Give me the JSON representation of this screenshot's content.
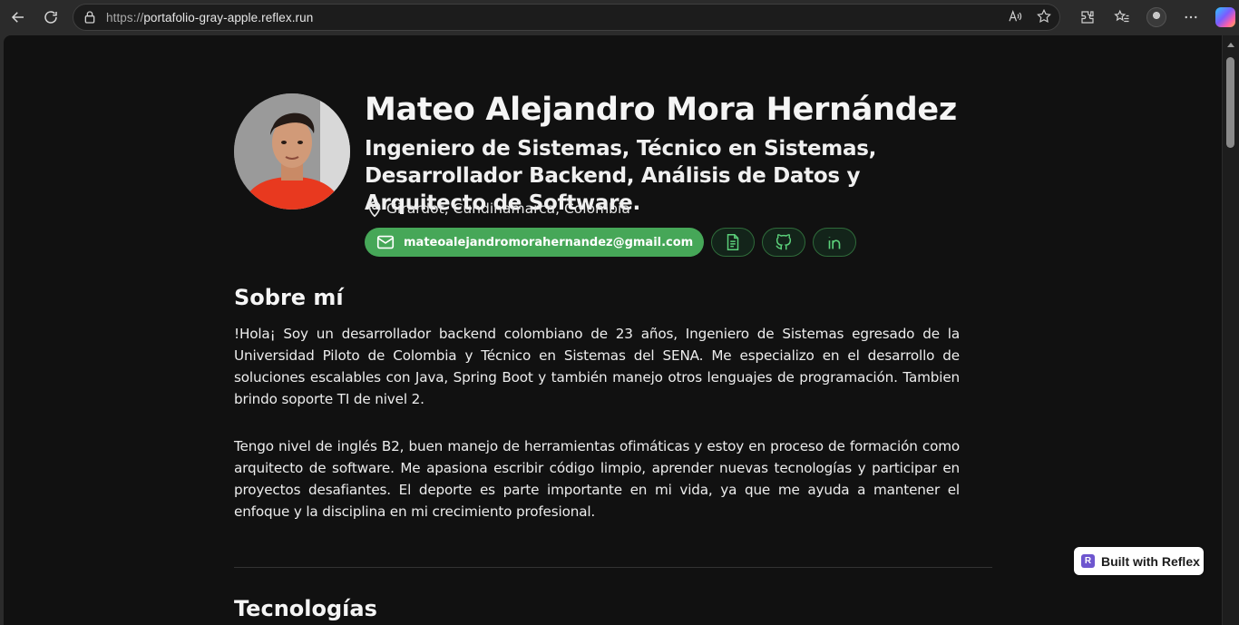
{
  "browser": {
    "url_scheme": "https://",
    "url_host": "portafolio-gray-apple.reflex.run"
  },
  "profile": {
    "name": "Mateo Alejandro Mora Hernández",
    "subtitle": "Ingeniero de Sistemas, Técnico en Sistemas, Desarrollador Backend, Análisis de Datos y Arquitecto de Software.",
    "location": "Girardot, Cundinamarca, Colombia",
    "email": "mateoalejandromorahernandez@gmail.com"
  },
  "about": {
    "title": "Sobre mí",
    "paragraph1": "!Hola¡ Soy un desarrollador backend colombiano de 23 años, Ingeniero de Sistemas egresado de la Universidad Piloto de Colombia y Técnico en Sistemas del SENA. Me especializo en el desarrollo de soluciones escalables con Java, Spring Boot y también manejo otros lenguajes de programación. Tambien brindo soporte TI de nivel 2.",
    "paragraph2": "Tengo nivel de inglés B2, buen manejo de herramientas ofimáticas y estoy en proceso de formación como arquitecto de software. Me apasiona escribir código limpio, aprender nuevas tecnologías y participar en proyectos desafiantes. El deporte es parte importante en mi vida, ya que me ayuda a mantener el enfoque y la disciplina en mi crecimiento profesional."
  },
  "technologies": {
    "title": "Tecnologías"
  },
  "badge": {
    "label": "Built with Reflex",
    "logo_letter": "R"
  },
  "colors": {
    "accent": "#46a758",
    "background": "#111111"
  }
}
